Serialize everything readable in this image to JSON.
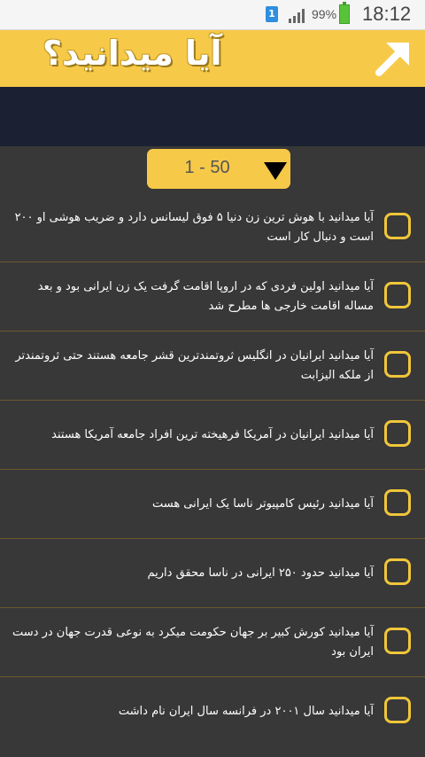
{
  "status_bar": {
    "notification_badge": "1",
    "battery_percent": "99%",
    "time": "18:12",
    "icons": [
      "notification-icon",
      "signal-icon",
      "battery-icon"
    ]
  },
  "header": {
    "title": "آیا میدانید؟",
    "icon": "arrow-up-right-icon"
  },
  "range_selector": {
    "value": "1 - 50",
    "icon": "caret-down-icon"
  },
  "items": [
    {
      "text": "آیا میدانید با هوش ترین زن دنیا ۵ فوق لیسانس دارد و ضریب هوشی او ۲۰۰ است و دنبال کار است",
      "checked": false
    },
    {
      "text": "آیا میدانید اولین فردی که در اروپا اقامت گرفت یک زن ایرانی بود و بعد مساله اقامت خارجی ها مطرح شد",
      "checked": false
    },
    {
      "text": "آیا میدانید ایرانیان در انگلیس ثروتمندترین قشر جامعه هستند حتی ثروتمندتر از ملکه الیزابت",
      "checked": false
    },
    {
      "text": "آیا میدانید ایرانیان در آمریکا فرهیخته ترین افراد جامعه آمریکا هستند",
      "checked": false
    },
    {
      "text": "آیا میدانید رئیس کامپیوتر ناسا یک ایرانی هست",
      "checked": false
    },
    {
      "text": "آیا میدانید حدود ۲۵۰ ایرانی در ناسا محقق داریم",
      "checked": false
    },
    {
      "text": "آیا میدانید کورش کبیر بر جهان حکومت میکرد به نوعی قدرت جهان در دست ایران بود",
      "checked": false
    },
    {
      "text": "آیا میدانید سال ۲۰۰۱ در فرانسه سال ایران نام داشت",
      "checked": false
    }
  ],
  "colors": {
    "accent": "#f7c948",
    "background": "#383838",
    "band": "#1b2132",
    "divider": "#6a5a2c",
    "checkbox_border": "#f0c63a"
  }
}
